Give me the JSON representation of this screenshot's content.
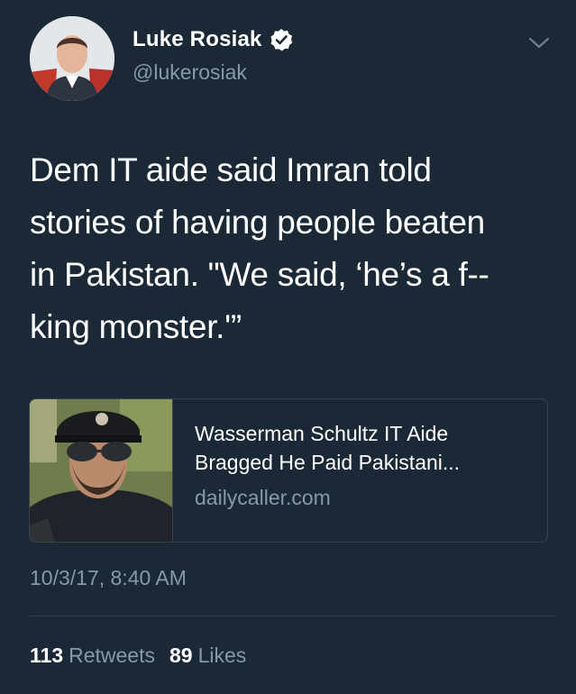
{
  "author": {
    "display_name": "Luke Rosiak",
    "handle": "@lukerosiak",
    "verified": true
  },
  "tweet": {
    "text": "Dem IT aide said Imran told\nstories of having people beaten\nin Pakistan. \"We said, ‘he’s a f--\nking monster.'”",
    "timestamp": "10/3/17, 8:40 AM"
  },
  "link_card": {
    "title": "Wasserman Schultz IT Aide\nBragged He Paid Pakistani...",
    "domain": "dailycaller.com"
  },
  "stats": {
    "retweets_count": "113",
    "retweets_label": "Retweets",
    "likes_count": "89",
    "likes_label": "Likes"
  },
  "colors": {
    "background": "#1b2836",
    "secondary_text": "#8899a6",
    "verified_blue": "#ffffff",
    "border": "#38444d"
  },
  "icons": {
    "verified": "verified-badge-icon",
    "menu": "chevron-down-icon"
  }
}
